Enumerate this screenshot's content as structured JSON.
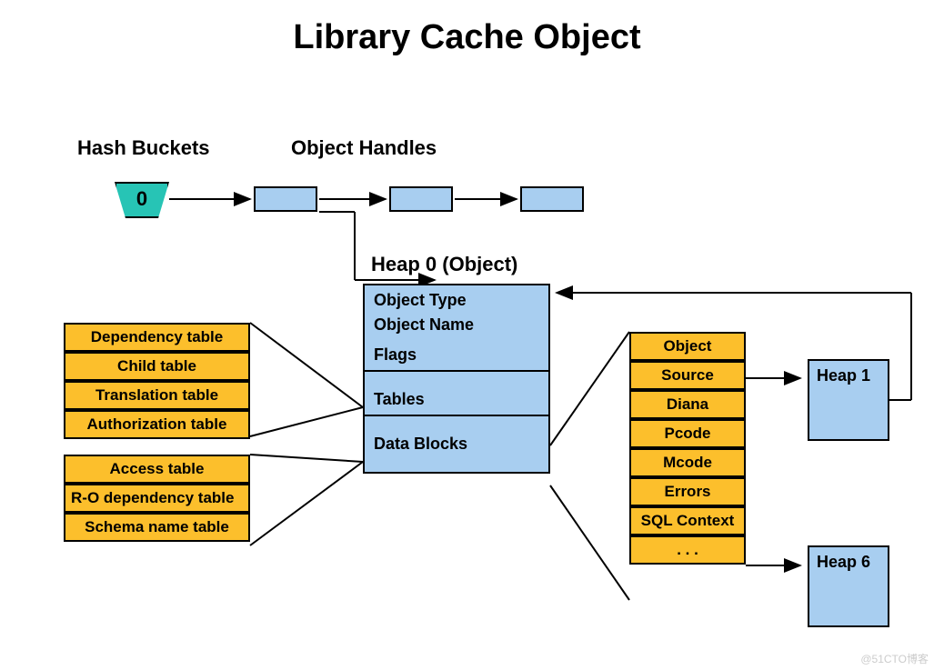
{
  "title": "Library Cache Object",
  "labels": {
    "hash_buckets": "Hash Buckets",
    "object_handles": "Object Handles",
    "heap0": "Heap 0 (Object)"
  },
  "bucket_value": "0",
  "heap0_rows": {
    "type": "Object Type",
    "name": "Object Name",
    "flags": "Flags",
    "tables": "Tables",
    "data_blocks": "Data Blocks"
  },
  "left_tables_group1": [
    "Dependency table",
    "Child table",
    "Translation table",
    "Authorization table"
  ],
  "left_tables_group2": [
    "Access table",
    "R-O dependency table",
    "Schema name table"
  ],
  "right_blocks": [
    "Object",
    "Source",
    "Diana",
    "Pcode",
    "Mcode",
    "Errors",
    "SQL Context",
    ". . ."
  ],
  "heaps": {
    "heap1": "Heap 1",
    "heap6": "Heap 6"
  },
  "watermark": "@51CTO博客"
}
